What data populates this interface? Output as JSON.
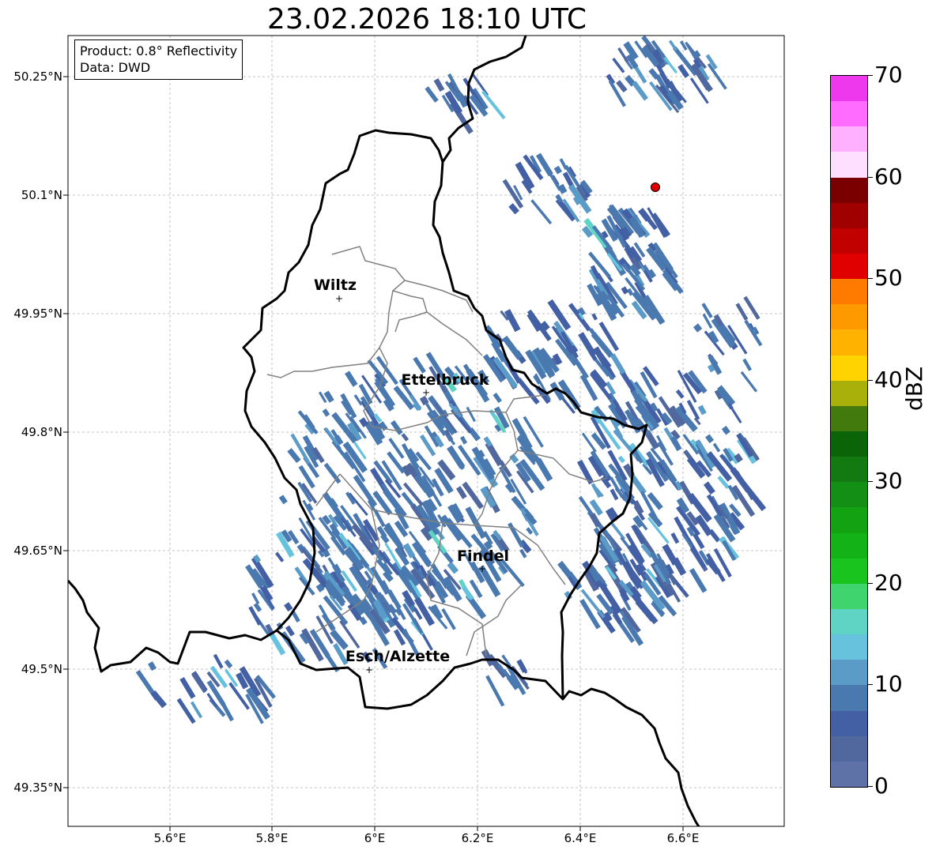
{
  "title": "23.02.2026 18:10 UTC",
  "info": {
    "product": "Product: 0.8° Reflectivity",
    "source": "Data: DWD"
  },
  "lat_labels": [
    "50.25°N",
    "50.1°N",
    "49.95°N",
    "49.8°N",
    "49.65°N",
    "49.5°N",
    "49.35°N"
  ],
  "lon_labels": [
    "5.6°E",
    "5.8°E",
    "6°E",
    "6.2°E",
    "6.4°E",
    "6.6°E"
  ],
  "cities": [
    {
      "name": "Wiltz"
    },
    {
      "name": "Ettelbruck"
    },
    {
      "name": "Findel"
    },
    {
      "name": "Esch/Alzette"
    }
  ],
  "colorbar": {
    "title": "dBZ",
    "min": 0,
    "max": 70,
    "step": 2.5,
    "tick_labels": [
      "0",
      "10",
      "20",
      "30",
      "40",
      "50",
      "60",
      "70"
    ],
    "colors": [
      "#5f72a8",
      "#51689f",
      "#4460a5",
      "#4a79b0",
      "#5a9bc8",
      "#67c2dd",
      "#5fd3c4",
      "#3fd46e",
      "#18c41d",
      "#13b317",
      "#12a212",
      "#138f16",
      "#127a11",
      "#0c6409",
      "#437a0d",
      "#aab00a",
      "#ffd300",
      "#ffb300",
      "#ff9900",
      "#ff7b00",
      "#e00000",
      "#c10000",
      "#a10000",
      "#7a0000",
      "#ffdfff",
      "#ffb0ff",
      "#ff6cff",
      "#ee38ee"
    ]
  },
  "radar_site_color": "#e00000"
}
